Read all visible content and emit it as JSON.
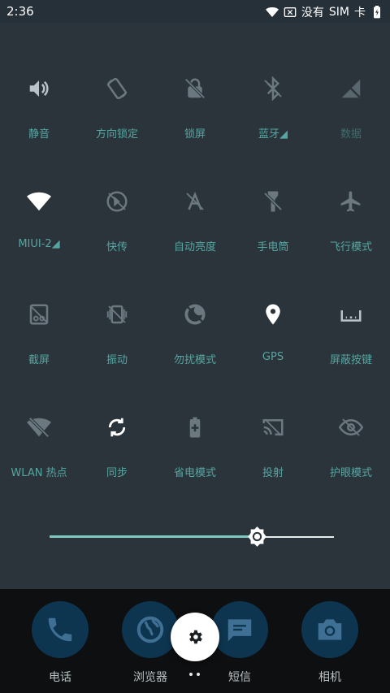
{
  "statusbar": {
    "time": "2:36",
    "no_service": "没有",
    "sim": "SIM",
    "sim_suffix": "卡",
    "icons": [
      "wifi-icon",
      "sim-x-icon",
      "battery-charging-icon"
    ]
  },
  "tiles": [
    {
      "label": "静音",
      "icon": "volume-icon"
    },
    {
      "label": "方向锁定",
      "icon": "rotate-lock-icon"
    },
    {
      "label": "锁屏",
      "icon": "lock-screen-icon"
    },
    {
      "label": "蓝牙◢",
      "icon": "bluetooth-icon"
    },
    {
      "label": "数据",
      "icon": "mobile-data-off-icon"
    },
    {
      "label": "MIUI-2◢",
      "icon": "wifi-icon"
    },
    {
      "label": "快传",
      "icon": "quick-transfer-icon"
    },
    {
      "label": "自动亮度",
      "icon": "auto-brightness-icon"
    },
    {
      "label": "手电筒",
      "icon": "flashlight-icon"
    },
    {
      "label": "飞行模式",
      "icon": "airplane-icon"
    },
    {
      "label": "截屏",
      "icon": "screenshot-icon"
    },
    {
      "label": "振动",
      "icon": "vibrate-icon"
    },
    {
      "label": "勿扰模式",
      "icon": "do-not-disturb-icon"
    },
    {
      "label": "GPS",
      "icon": "location-icon"
    },
    {
      "label": "屏蔽按键",
      "icon": "block-keys-icon"
    },
    {
      "label": "WLAN 热点",
      "icon": "hotspot-icon"
    },
    {
      "label": "同步",
      "icon": "sync-icon"
    },
    {
      "label": "省电模式",
      "icon": "battery-saver-icon"
    },
    {
      "label": "投射",
      "icon": "cast-icon"
    },
    {
      "label": "护眼模式",
      "icon": "eye-care-icon"
    }
  ],
  "brightness": {
    "level": 0.73
  },
  "dock": {
    "apps": [
      {
        "label": "电话",
        "icon": "phone-icon"
      },
      {
        "label": "浏览器",
        "icon": "browser-icon"
      },
      {
        "label": "短信",
        "icon": "message-icon"
      },
      {
        "label": "相机",
        "icon": "camera-icon"
      }
    ],
    "settings_icon": "gear-icon"
  },
  "colors": {
    "accent": "#55a6a2",
    "panel": "#2b343b",
    "slider_fill": "#7fc9c1"
  }
}
